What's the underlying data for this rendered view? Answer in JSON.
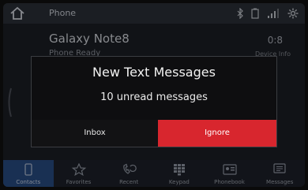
{
  "status_bar": {
    "title": "Phone",
    "icons": [
      "home-icon",
      "bluetooth-icon",
      "battery-icon",
      "signal-icon",
      "settings-icon"
    ]
  },
  "device": {
    "name": "Galaxy Note8",
    "status": "Phone Ready",
    "right_label": "0:8",
    "right_sub": "Device Info"
  },
  "dialog": {
    "title": "New Text Messages",
    "message": "10 unread messages",
    "inbox_label": "Inbox",
    "ignore_label": "Ignore"
  },
  "bottom_nav": {
    "items": [
      {
        "label": "Contacts",
        "icon": "phone-icon"
      },
      {
        "label": "Favorites",
        "icon": "star-icon"
      },
      {
        "label": "Recent",
        "icon": "recent-calls-icon"
      },
      {
        "label": "Keypad",
        "icon": "keypad-icon"
      },
      {
        "label": "Phonebook",
        "icon": "phonebook-icon"
      },
      {
        "label": "Messages",
        "icon": "messages-icon"
      }
    ]
  },
  "colors": {
    "accent_red": "#d8262e",
    "active_blue": "#274a80"
  }
}
